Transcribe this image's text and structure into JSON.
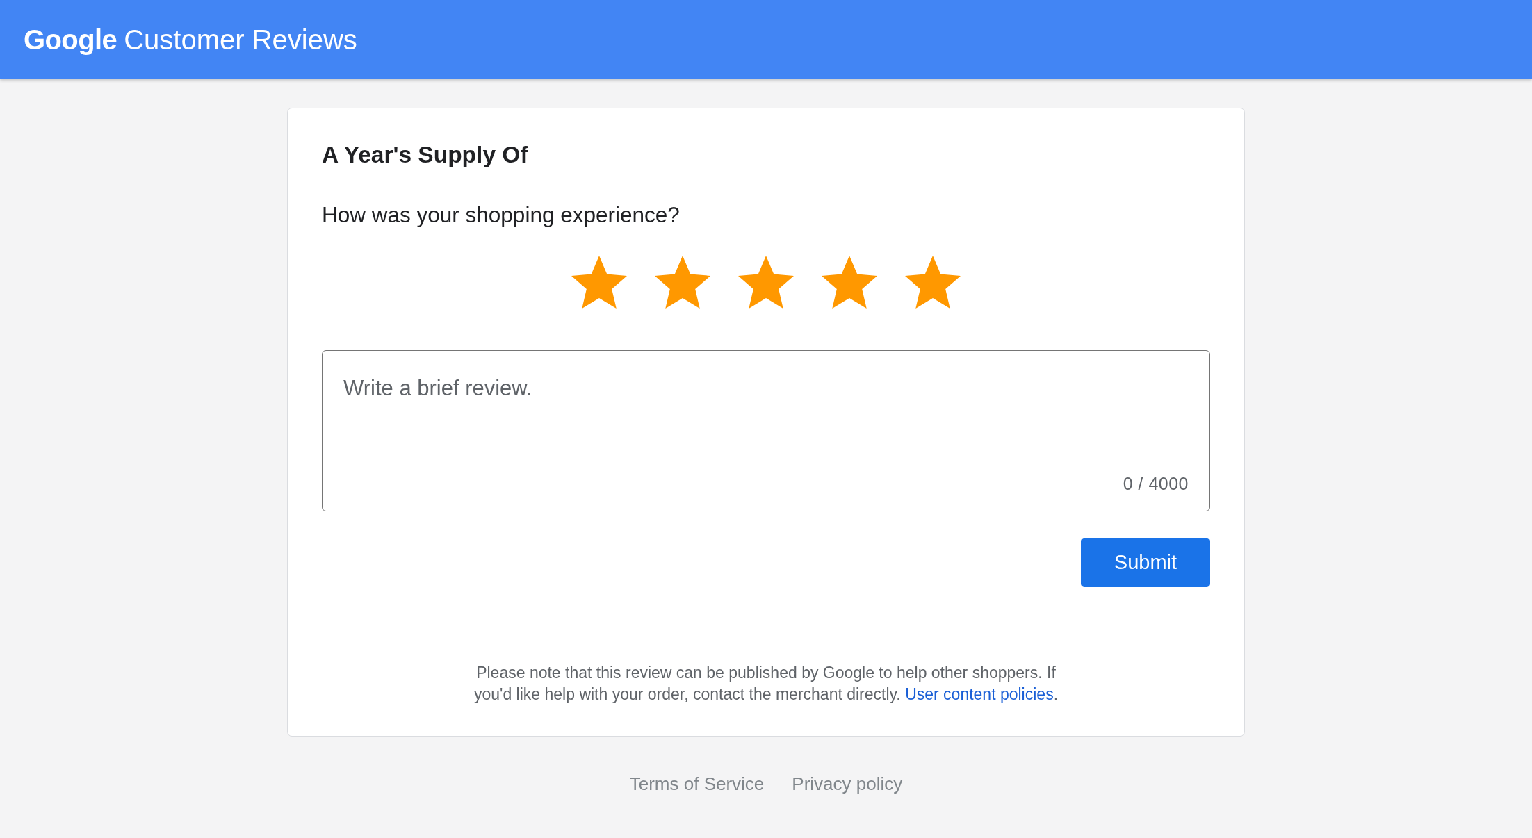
{
  "header": {
    "logo": "Google",
    "title": "Customer Reviews"
  },
  "review_card": {
    "product_title": "A Year's Supply Of",
    "question": "How was your shopping experience?",
    "rating": {
      "stars": 5
    },
    "review_field": {
      "placeholder": "Write a brief review.",
      "counter": "0 / 4000"
    },
    "submit_button": "Submit",
    "notice": {
      "lines": [
        "Please note that this review can be published by Google to help other shoppers. If",
        "you'd like help with your order, contact the merchant directly."
      ],
      "link": "User content policies",
      "end": "."
    }
  },
  "footer_links": [
    "Terms of Service",
    "Privacy policy"
  ]
}
